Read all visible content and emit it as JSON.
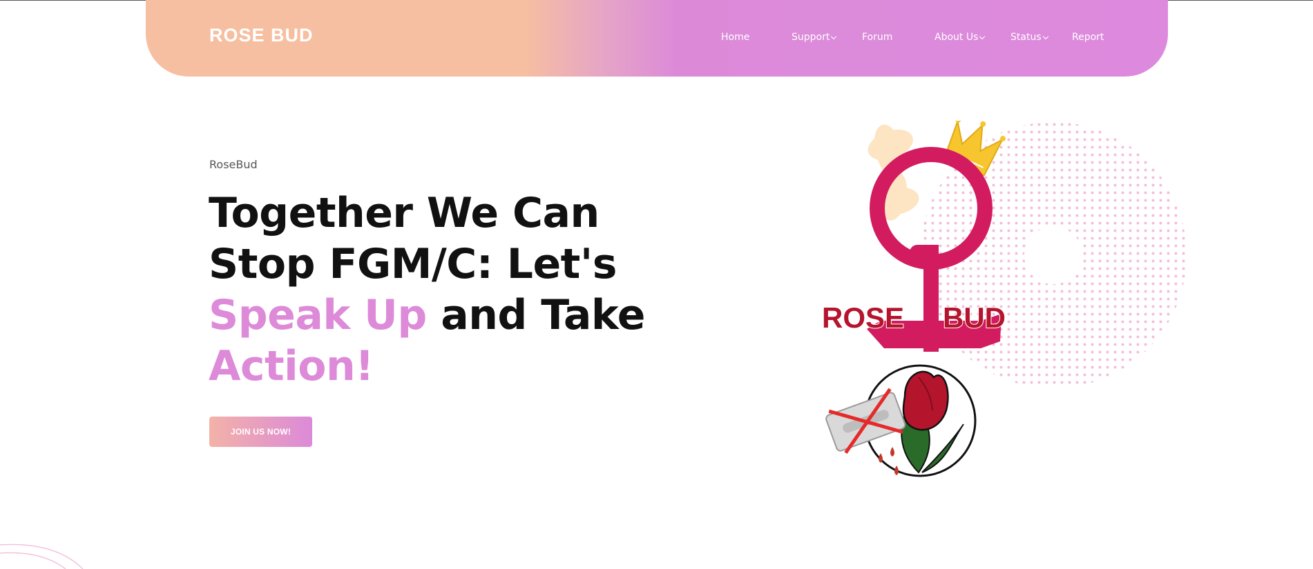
{
  "header": {
    "brand": "ROSE BUD",
    "nav": [
      {
        "label": "Home",
        "has_dropdown": false
      },
      {
        "label": "Support",
        "has_dropdown": true
      },
      {
        "label": "Forum",
        "has_dropdown": false
      },
      {
        "label": "About Us",
        "has_dropdown": true
      },
      {
        "label": "Status",
        "has_dropdown": true
      },
      {
        "label": "Report",
        "has_dropdown": false
      }
    ]
  },
  "hero": {
    "kicker": "RoseBud",
    "headline": {
      "line1": "Together We Can",
      "line2": "Stop FGM/C: Let's",
      "accent1": "Speak Up",
      "line3_rest": " and Take",
      "accent2": "Action!"
    },
    "cta_label": "JOIN US NOW!"
  },
  "logo": {
    "text_left": "ROSE",
    "text_right": "BUD"
  },
  "colors": {
    "header_start": "#f6bfa1",
    "header_end": "#dd8ade",
    "accent": "#dd8ad9",
    "logo_pink": "#d21c5f",
    "logo_text": "#b5142d",
    "crown": "#f7c62f",
    "petal": "#fde4c2",
    "leaf": "#2a6b2a"
  },
  "icons": [
    "support-chevron-down-icon",
    "about-chevron-down-icon",
    "status-chevron-down-icon"
  ]
}
